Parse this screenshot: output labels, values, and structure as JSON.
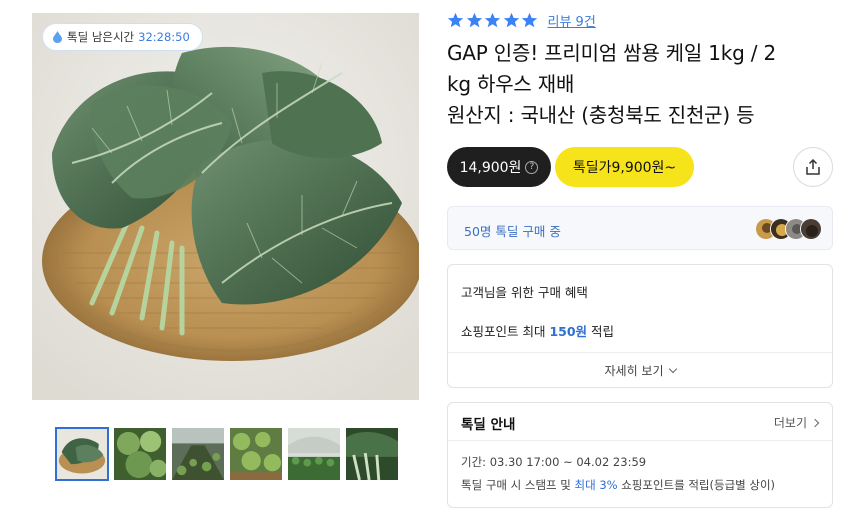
{
  "product": {
    "title_line1": "GAP 인증! 프리미엄 쌈용 케일 1kg / 2",
    "title_line2": "kg 하우스 재배",
    "title_line3": "원산지 : 국내산 (충청북도 진천군) 등",
    "image_alt": "케일 잎이 담긴 대나무 채반",
    "thumbnail_count": 6
  },
  "timer": {
    "label": "톡딜 남은시간",
    "value": "32:28:50"
  },
  "rating": {
    "stars": 5,
    "review_link": "리뷰 9건",
    "star_color": "#3b82f6"
  },
  "price": {
    "regular": "14,900원",
    "help_icon": "?",
    "deal": "톡딜가9,900원~"
  },
  "buyers": {
    "text": "50명 톡딜 구매 중"
  },
  "benefits": {
    "heading": "고객님을 위한 구매 혜택",
    "points_prefix": "쇼핑포인트 최대 ",
    "points_value": "150원",
    "points_suffix": " 적립",
    "detail_button": "자세히 보기"
  },
  "deal_info": {
    "heading": "톡딜 안내",
    "more_link": "더보기",
    "period": "기간: 03.30 17:00 ~ 04.02 23:59",
    "stamp_prefix": "톡딜 구매 시 스탬프 및 ",
    "stamp_highlight": "최대 3%",
    "stamp_suffix": " 쇼핑포인트를 적립(등급별 상이)"
  },
  "colors": {
    "accent_blue": "#2f6fd6",
    "deal_yellow": "#f7e31a",
    "price_dark": "#1f1f1f"
  }
}
